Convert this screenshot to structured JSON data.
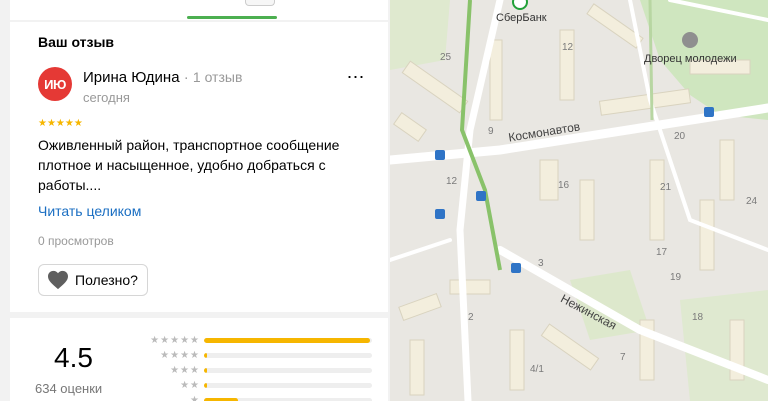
{
  "review_section": {
    "title": "Ваш отзыв",
    "avatar_initials": "ИЮ",
    "author_name": "Ирина Юдина",
    "author_separator": " · ",
    "author_review_count": "1 отзыв",
    "date": "сегодня",
    "stars_display": "★★★★★",
    "rating": 5,
    "text": "Оживленный район, транспортное сообщение плотное и насыщенное, удобно добраться с работы....",
    "read_more": "Читать целиком",
    "views": "0 просмотров",
    "helpful_label": "Полезно?",
    "more_menu": "⋯"
  },
  "rating_summary": {
    "average": "4.5",
    "count_label": "634 оценки",
    "distribution": [
      {
        "stars": "★★★★★",
        "fraction": 0.99
      },
      {
        "stars": "★★★★",
        "fraction": 0.02
      },
      {
        "stars": "★★★",
        "fraction": 0.02
      },
      {
        "stars": "★★",
        "fraction": 0.02
      },
      {
        "stars": "★",
        "fraction": 0.2
      }
    ]
  },
  "map": {
    "poi_sberbank": "СберБанк",
    "poi_palace": "Дворец молодежи",
    "street_cosmonauts": "Космонавтов",
    "street_nezhinskaya": "Нежинская",
    "house_numbers": [
      "25",
      "12",
      "9",
      "20",
      "16",
      "21",
      "24",
      "3",
      "17",
      "19",
      "2",
      "18",
      "4/1",
      "7",
      "12"
    ]
  },
  "colors": {
    "accent_green": "#4caf50",
    "star_yellow": "#f6b600",
    "link_blue": "#1a6ec2",
    "avatar_red": "#e53935"
  }
}
